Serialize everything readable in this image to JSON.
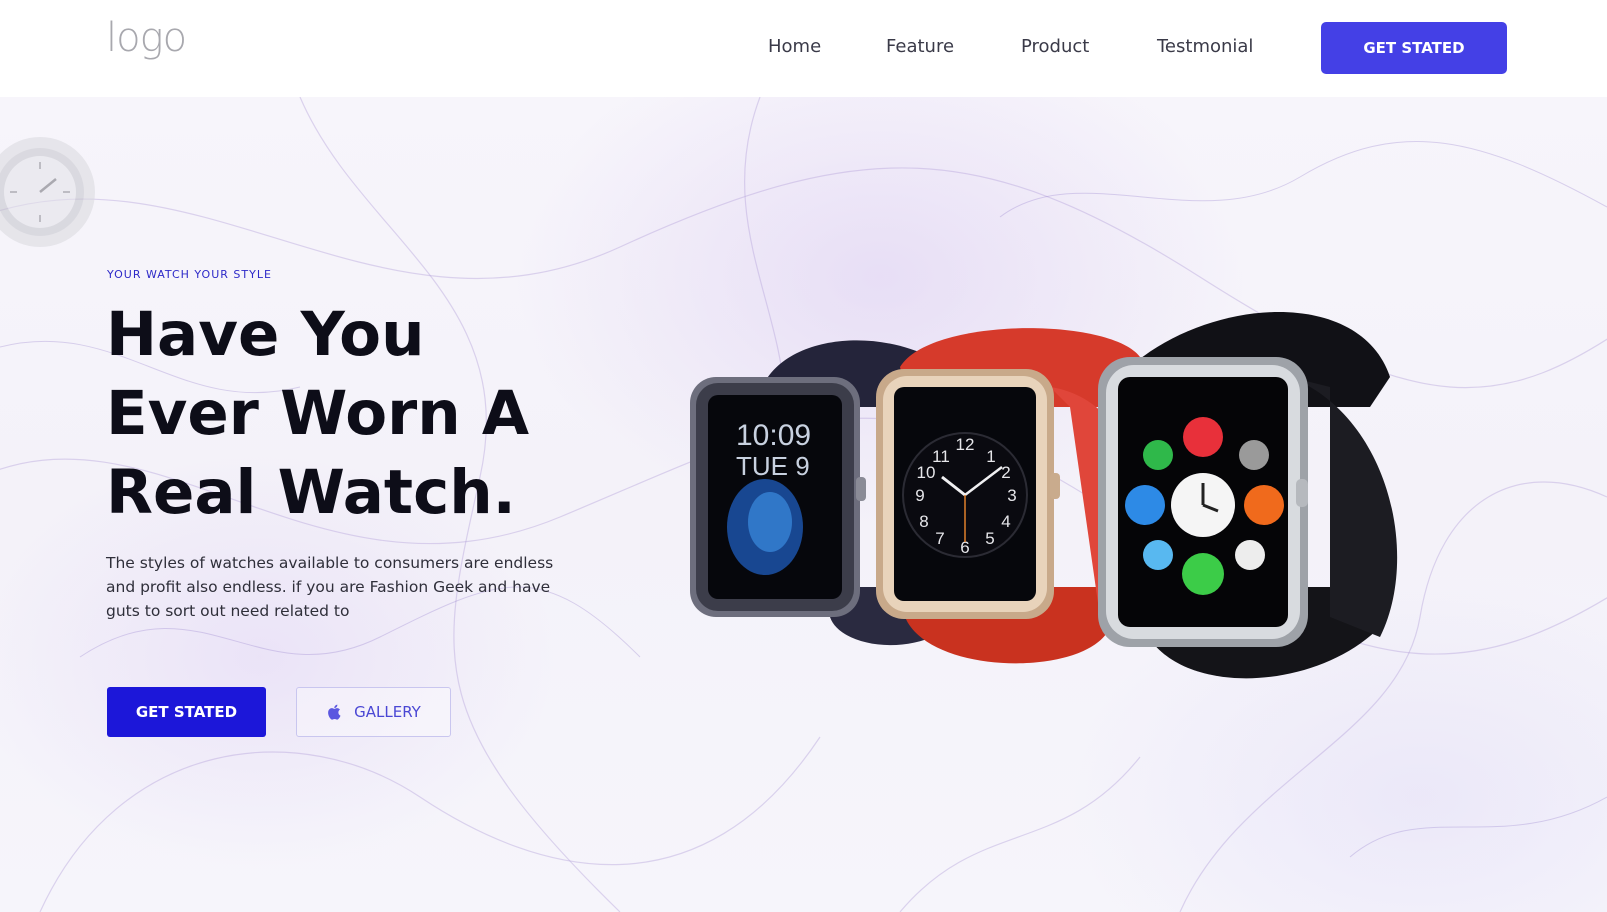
{
  "header": {
    "logo_text": "logo",
    "nav": [
      {
        "label": "Home"
      },
      {
        "label": "Feature"
      },
      {
        "label": "Product"
      },
      {
        "label": "Testmonial"
      }
    ],
    "cta_label": "GET STATED"
  },
  "hero": {
    "eyebrow": "YOUR WATCH YOUR STYLE",
    "headline_lines": [
      "Have You",
      "Ever Worn A",
      "Real Watch."
    ],
    "description": "The styles of watches available to consumers are endless and profit also endless. if you are Fashion Geek and have guts to sort out need related to",
    "primary_button": "GET STATED",
    "gallery_button": "GALLERY",
    "gallery_icon": "apple-icon"
  },
  "product_image": {
    "watches": [
      {
        "band": "navy",
        "screen": "10:09 TUE 9"
      },
      {
        "band": "red",
        "screen": "analog clock"
      },
      {
        "band": "black",
        "screen": "app grid"
      }
    ],
    "watch_left_time": "10:09",
    "watch_left_date": "TUE 9"
  },
  "colors": {
    "accent": "#4440e6",
    "primary_button": "#1c17d9",
    "eyebrow": "#2e2ac8",
    "headline": "#0d0d18"
  }
}
